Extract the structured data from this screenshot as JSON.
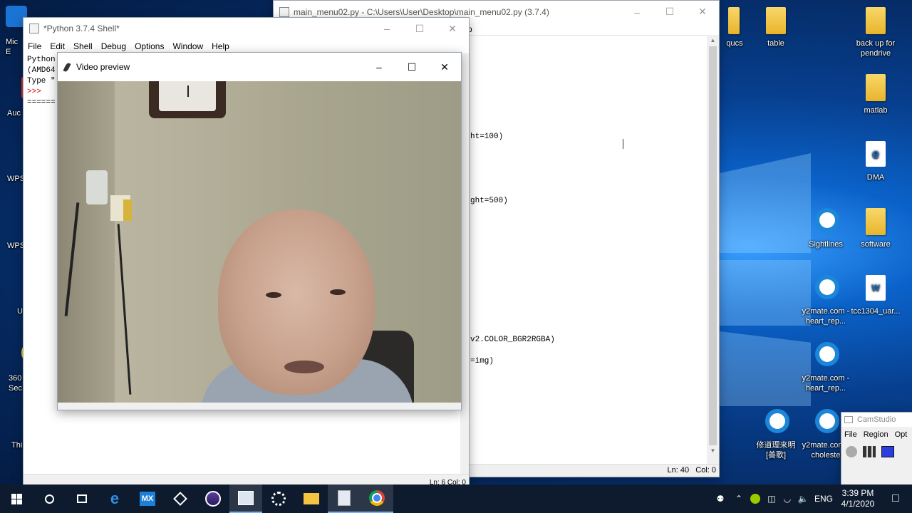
{
  "desktop": {
    "left_icons": [
      {
        "label": "Mic\nE",
        "icon": "edge-icon"
      },
      {
        "label": "Auc",
        "icon": "app-icon"
      },
      {
        "label": "WPS",
        "icon": "wps-icon"
      },
      {
        "label": "WPS",
        "icon": "wps-icon"
      },
      {
        "label": "U",
        "icon": "folder-icon"
      },
      {
        "label": "360\nSec",
        "icon": "360-icon"
      },
      {
        "label": "Thi",
        "icon": "pc-icon"
      }
    ],
    "right_icons": [
      {
        "label": "qucs",
        "icon": "folder-icon"
      },
      {
        "label": "table",
        "icon": "folder-icon"
      },
      {
        "label": "back up for pendrive",
        "icon": "folder-icon"
      },
      {
        "label": "matlab",
        "icon": "folder-icon"
      },
      {
        "label": "DMA",
        "icon": "edge-doc-icon"
      },
      {
        "label": "Sightlines",
        "icon": "target-icon"
      },
      {
        "label": "software",
        "icon": "folder-icon"
      },
      {
        "label": "y2mate.com - heart_rep...",
        "icon": "target-icon"
      },
      {
        "label": "tcc1304_uar...",
        "icon": "doc-icon"
      },
      {
        "label": "y2mate.com - heart_rep...",
        "icon": "target-icon"
      },
      {
        "label": "修道理来明 [善歌]",
        "icon": "target-icon"
      },
      {
        "label": "y2mate.com - choleste",
        "icon": "target-icon"
      }
    ]
  },
  "editor_window": {
    "title": "main_menu02.py - C:\\Users\\User\\Desktop\\main_menu02.py (3.7.4)",
    "code_fragments": [
      "ht=100)",
      "ght=500)",
      "v2.COLOR_BGR2RGBA)",
      "=img)"
    ],
    "status": "Ln: 40   Col: 0",
    "menu_fragment": "p"
  },
  "shell_window": {
    "title": "*Python 3.7.4 Shell*",
    "menu": [
      "File",
      "Edit",
      "Shell",
      "Debug",
      "Options",
      "Window",
      "Help"
    ],
    "lines": [
      "Python",
      "(AMD64",
      "Type \"",
      ">>>",
      "======"
    ],
    "status_fragment": "Ln: 6  Col: 0"
  },
  "video_window": {
    "title": "Video preview"
  },
  "camstudio": {
    "title": "CamStudio",
    "menu": [
      "File",
      "Region",
      "Opt"
    ]
  },
  "taskbar": {
    "apps": [
      "start-icon",
      "search-icon",
      "task-view-icon",
      "edge-icon",
      "mx-icon",
      "app-icon",
      "eclipse-icon",
      "python-shell-icon",
      "settings-app-icon",
      "explorer-icon",
      "idle-icon",
      "chrome-icon"
    ],
    "lang": "ENG",
    "time": "3:39 PM",
    "date": "4/1/2020"
  },
  "colors": {
    "accent": "#0078d7",
    "taskbar": "#0e1b2f"
  }
}
